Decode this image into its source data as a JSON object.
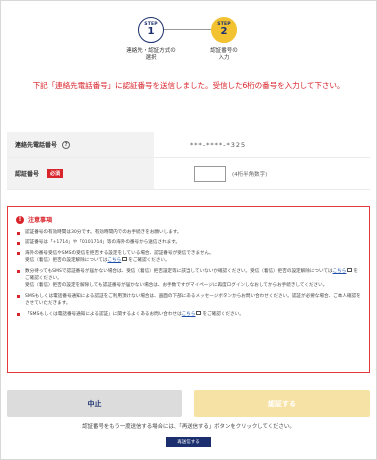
{
  "steps": [
    {
      "word": "STEP",
      "num": "1",
      "caption_line1": "連絡先・認証方式の",
      "caption_line2": "選択"
    },
    {
      "word": "STEP",
      "num": "2",
      "caption_line1": "認証番号の",
      "caption_line2": "入力"
    }
  ],
  "instruction": "下記「連絡先電話番号」に認証番号を送信しました。受信した6桁の番号を入力して下さい。",
  "form": {
    "phone_label": "連絡先電話番号",
    "phone_value": "***-****-*325",
    "code_label": "認証番号",
    "required_badge": "必須",
    "code_value": "",
    "code_hint": "(4桁半角数字)",
    "help_glyph": "?"
  },
  "notes": {
    "title": "注意事項",
    "items": [
      {
        "text": "認証番号の有効時間は30分です。有効時間内でのお手続きをお願いします。"
      },
      {
        "text": "認証番号は「+1714」や「0101714」等の海外の番号から送信されます。"
      },
      {
        "text": "海外の番号受信やSMSの受信を拒否する設定をしている場合、認証番号が受信できません。",
        "text2": "受信（着信）拒否の設定解除については",
        "link": "こちら",
        "text3": "をご確認ください。"
      },
      {
        "text": "数分待ってもSMSで認証番号が届かない場合は、受信（着信）拒否設定等に該当していないか確認ください。受信（着信）拒否の設定解除については",
        "link": "こちら",
        "text3": "をご確認ください。",
        "text4": "受信（着信）拒否の設定を解除しても認証番号が届かない場合は、お手数ですがマイページに再度ログインしなおしてからお手続きしてください。"
      },
      {
        "text": "SMSもしくは電話番号通知による認証をご利用頂けない場合は、画面の下部にあるメッセージボタンからお問い合わせください。認証が必要な場合、ご本人確認をさせていただきます。"
      },
      {
        "text": "「SMSもしくは電話番号通知による認証」に関するよくあるお問い合わせは",
        "link": "こちら",
        "text3": "をご確認ください。"
      }
    ]
  },
  "buttons": {
    "cancel": "中止",
    "authenticate": "認証する",
    "resend_note": "認証番号をもう一度送信する場合には、「再送信する」ボタンをクリックしてください。",
    "resend": "再送信する"
  },
  "colors": {
    "accent_red": "#d8242b",
    "navy": "#1b2f6e",
    "step_active": "#f2c230",
    "auth_disabled": "#f6e2a4"
  }
}
